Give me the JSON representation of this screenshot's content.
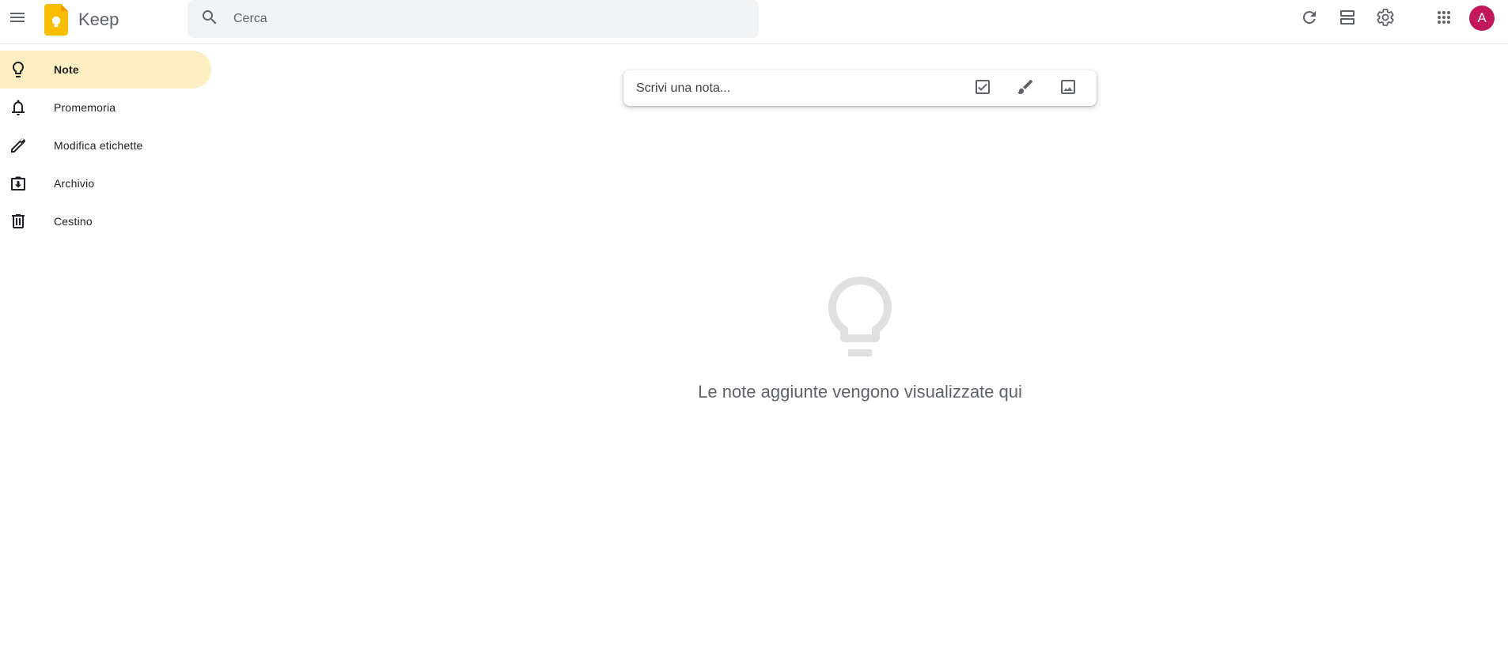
{
  "header": {
    "app_title": "Keep",
    "menu_icon": "menu-icon",
    "logo_icon": "keep-logo-icon",
    "search": {
      "placeholder": "Cerca",
      "value": ""
    },
    "actions": [
      "refresh-icon",
      "list-view-icon",
      "settings-icon",
      "apps-grid-icon"
    ],
    "avatar": {
      "initial": "A",
      "color": "#c2185b"
    }
  },
  "sidebar": {
    "active_color": "#feefc3",
    "items": [
      {
        "label": "Note",
        "icon": "lightbulb-icon",
        "active": true
      },
      {
        "label": "Promemoria",
        "icon": "bell-icon",
        "active": false
      },
      {
        "label": "Modifica etichette",
        "icon": "pencil-icon",
        "active": false
      },
      {
        "label": "Archivio",
        "icon": "archive-icon",
        "active": false
      },
      {
        "label": "Cestino",
        "icon": "trash-icon",
        "active": false
      }
    ]
  },
  "take_note": {
    "placeholder": "Scrivi una nota...",
    "actions": [
      "checkbox-list-icon",
      "brush-icon",
      "image-icon"
    ]
  },
  "empty_state": {
    "icon": "lightbulb-icon",
    "message": "Le note aggiunte vengono visualizzate qui"
  },
  "colors": {
    "logo_yellow": "#fbbc04",
    "search_bg": "#f1f3f4",
    "text_secondary": "#5f6368"
  }
}
